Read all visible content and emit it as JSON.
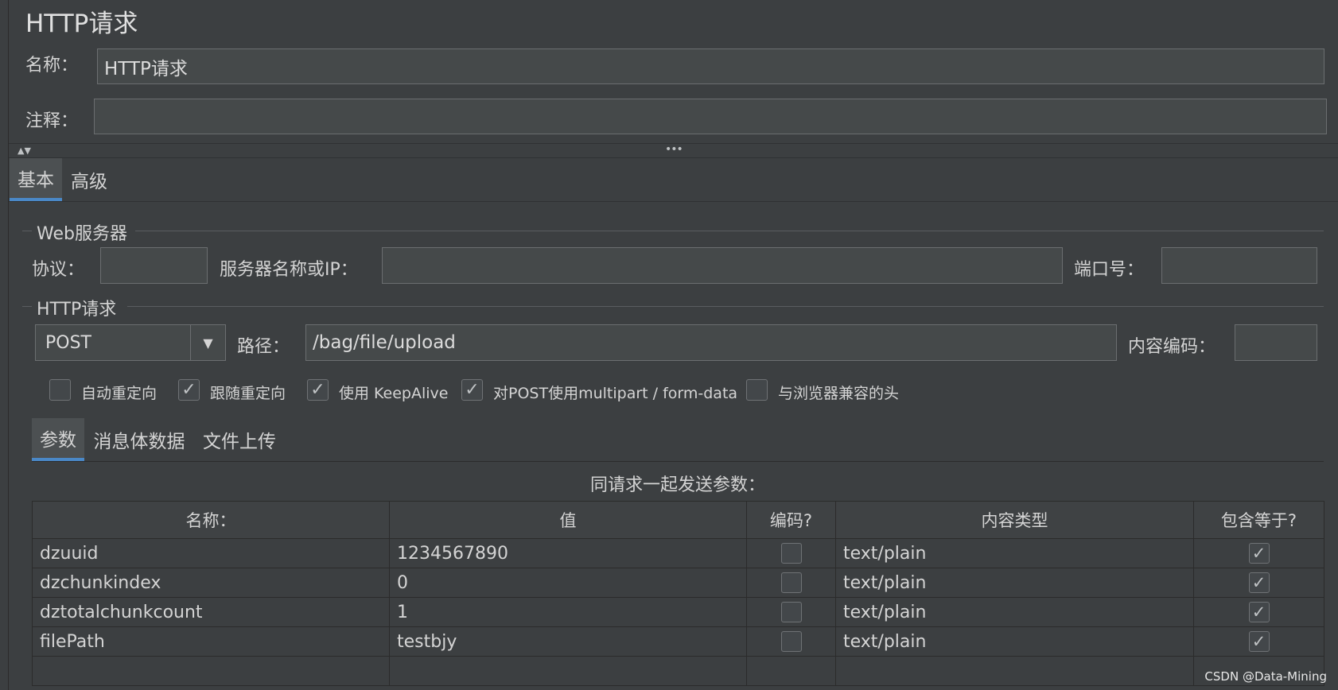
{
  "page": {
    "title": "HTTP请求",
    "name_label": "名称：",
    "name_value": "HTTP请求",
    "comment_label": "注释：",
    "comment_value": ""
  },
  "splitter": {
    "arrows": "▲▼",
    "handle": "•••"
  },
  "tabs": [
    {
      "label": "基本",
      "active": true
    },
    {
      "label": "高级",
      "active": false
    }
  ],
  "web_server": {
    "group_title": "Web服务器",
    "protocol_label": "协议：",
    "protocol_value": "",
    "server_label": "服务器名称或IP：",
    "server_value": "",
    "port_label": "端口号：",
    "port_value": ""
  },
  "http_request": {
    "group_title": "HTTP请求",
    "method": "POST",
    "path_label": "路径：",
    "path_value": "/bag/file/upload",
    "encoding_label": "内容编码：",
    "encoding_value": "",
    "options": [
      {
        "label": "自动重定向",
        "checked": false
      },
      {
        "label": "跟随重定向",
        "checked": true
      },
      {
        "label": "使用 KeepAlive",
        "checked": true
      },
      {
        "label": "对POST使用multipart / form-data",
        "checked": true
      },
      {
        "label": "与浏览器兼容的头",
        "checked": false
      }
    ]
  },
  "sub_tabs": [
    {
      "label": "参数",
      "active": true
    },
    {
      "label": "消息体数据",
      "active": false
    },
    {
      "label": "文件上传",
      "active": false
    }
  ],
  "params": {
    "caption": "同请求一起发送参数：",
    "headers": [
      "名称：",
      "值",
      "编码?",
      "内容类型",
      "包含等于?"
    ],
    "rows": [
      {
        "name": "dzuuid",
        "value": "1234567890",
        "encode": false,
        "type": "text/plain",
        "include_equals": true
      },
      {
        "name": "dzchunkindex",
        "value": "0",
        "encode": false,
        "type": "text/plain",
        "include_equals": true
      },
      {
        "name": "dztotalchunkcount",
        "value": "1",
        "encode": false,
        "type": "text/plain",
        "include_equals": true
      },
      {
        "name": "filePath",
        "value": "testbjy",
        "encode": false,
        "type": "text/plain",
        "include_equals": true
      }
    ]
  },
  "watermark": "CSDN @Data-Mining",
  "icons": {
    "check": "check-icon",
    "dropdown": "chevron-down-icon"
  },
  "colors": {
    "accent": "#4a88c7",
    "background": "#3c3f41",
    "field": "#45494a"
  }
}
